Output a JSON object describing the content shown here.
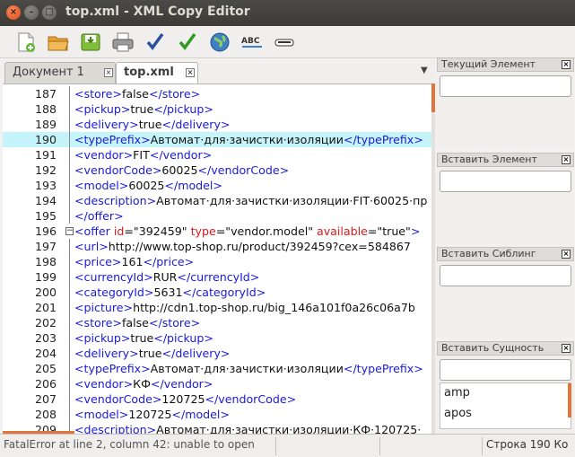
{
  "window": {
    "title": "top.xml - XML Copy Editor"
  },
  "toolbar": {
    "buttons": [
      "new-file",
      "open-folder",
      "save",
      "print",
      "check-wellformed",
      "validate",
      "web-browser",
      "spellcheck",
      "xslt"
    ]
  },
  "tabs": [
    {
      "label": "Документ 1",
      "active": false
    },
    {
      "label": "top.xml",
      "active": true
    }
  ],
  "code": {
    "lines": [
      {
        "n": "187",
        "segs": [
          [
            "t",
            "<store>"
          ],
          [
            "v",
            "false"
          ],
          [
            "t",
            "</store>"
          ]
        ]
      },
      {
        "n": "188",
        "segs": [
          [
            "t",
            "<pickup>"
          ],
          [
            "v",
            "true"
          ],
          [
            "t",
            "</pickup>"
          ]
        ]
      },
      {
        "n": "189",
        "segs": [
          [
            "t",
            "<delivery>"
          ],
          [
            "v",
            "true"
          ],
          [
            "t",
            "</delivery>"
          ]
        ]
      },
      {
        "n": "190",
        "hl": true,
        "segs": [
          [
            "t",
            "<typePrefix>"
          ],
          [
            "v",
            "Автомат·для·зачистки·изоляции"
          ],
          [
            "t",
            "</typePrefix>"
          ]
        ]
      },
      {
        "n": "191",
        "segs": [
          [
            "t",
            "<vendor>"
          ],
          [
            "v",
            "FIT"
          ],
          [
            "t",
            "</vendor>"
          ]
        ]
      },
      {
        "n": "192",
        "segs": [
          [
            "t",
            "<vendorCode>"
          ],
          [
            "v",
            "60025"
          ],
          [
            "t",
            "</vendorCode>"
          ]
        ]
      },
      {
        "n": "193",
        "segs": [
          [
            "t",
            "<model>"
          ],
          [
            "v",
            "60025"
          ],
          [
            "t",
            "</model>"
          ]
        ]
      },
      {
        "n": "194",
        "segs": [
          [
            "t",
            "<description>"
          ],
          [
            "v",
            "Автомат·для·зачистки·изоляции·FIT·60025·пр"
          ]
        ]
      },
      {
        "n": "195",
        "segs": [
          [
            "t",
            "</offer>"
          ]
        ]
      },
      {
        "n": "196",
        "fold": true,
        "segs": [
          [
            "t",
            "<offer "
          ],
          [
            "a",
            "id"
          ],
          [
            "v",
            "=\"392459\" "
          ],
          [
            "a",
            "type"
          ],
          [
            "v",
            "=\"vendor.model\" "
          ],
          [
            "a",
            "available"
          ],
          [
            "v",
            "=\"true\""
          ],
          [
            "t",
            ">"
          ]
        ]
      },
      {
        "n": "197",
        "segs": [
          [
            "t",
            "<url>"
          ],
          [
            "v",
            "http://www.top-shop.ru/product/392459?cex=584867"
          ]
        ]
      },
      {
        "n": "198",
        "segs": [
          [
            "t",
            "<price>"
          ],
          [
            "v",
            "161"
          ],
          [
            "t",
            "</price>"
          ]
        ]
      },
      {
        "n": "199",
        "segs": [
          [
            "t",
            "<currencyId>"
          ],
          [
            "v",
            "RUR"
          ],
          [
            "t",
            "</currencyId>"
          ]
        ]
      },
      {
        "n": "200",
        "segs": [
          [
            "t",
            "<categoryId>"
          ],
          [
            "v",
            "5631"
          ],
          [
            "t",
            "</categoryId>"
          ]
        ]
      },
      {
        "n": "201",
        "segs": [
          [
            "t",
            "<picture>"
          ],
          [
            "v",
            "http://cdn1.top-shop.ru/big_146a101f0a26c06a7b"
          ]
        ]
      },
      {
        "n": "202",
        "segs": [
          [
            "t",
            "<store>"
          ],
          [
            "v",
            "false"
          ],
          [
            "t",
            "</store>"
          ]
        ]
      },
      {
        "n": "203",
        "segs": [
          [
            "t",
            "<pickup>"
          ],
          [
            "v",
            "true"
          ],
          [
            "t",
            "</pickup>"
          ]
        ]
      },
      {
        "n": "204",
        "segs": [
          [
            "t",
            "<delivery>"
          ],
          [
            "v",
            "true"
          ],
          [
            "t",
            "</delivery>"
          ]
        ]
      },
      {
        "n": "205",
        "segs": [
          [
            "t",
            "<typePrefix>"
          ],
          [
            "v",
            "Автомат·для·зачистки·изоляции"
          ],
          [
            "t",
            "</typePrefix>"
          ]
        ]
      },
      {
        "n": "206",
        "segs": [
          [
            "t",
            "<vendor>"
          ],
          [
            "v",
            "КФ"
          ],
          [
            "t",
            "</vendor>"
          ]
        ]
      },
      {
        "n": "207",
        "segs": [
          [
            "t",
            "<vendorCode>"
          ],
          [
            "v",
            "120725"
          ],
          [
            "t",
            "</vendorCode>"
          ]
        ]
      },
      {
        "n": "208",
        "segs": [
          [
            "t",
            "<model>"
          ],
          [
            "v",
            "120725"
          ],
          [
            "t",
            "</model>"
          ]
        ]
      },
      {
        "n": "209",
        "segs": [
          [
            "t",
            "<description>"
          ],
          [
            "v",
            "Автомат·для·зачистки·изоляции·КФ·120725·"
          ]
        ]
      }
    ]
  },
  "side": {
    "current_element": {
      "title": "Текущий Элемент",
      "value": ""
    },
    "insert_element": {
      "title": "Вставить Элемент",
      "value": ""
    },
    "insert_sibling": {
      "title": "Вставить Сиблинг",
      "value": ""
    },
    "insert_entity": {
      "title": "Вставить Сущность",
      "value": "",
      "items": [
        "amp",
        "apos"
      ]
    }
  },
  "status": {
    "message": "FatalError at line 2, column 42: unable to open",
    "position": "Строка 190 Ко"
  }
}
